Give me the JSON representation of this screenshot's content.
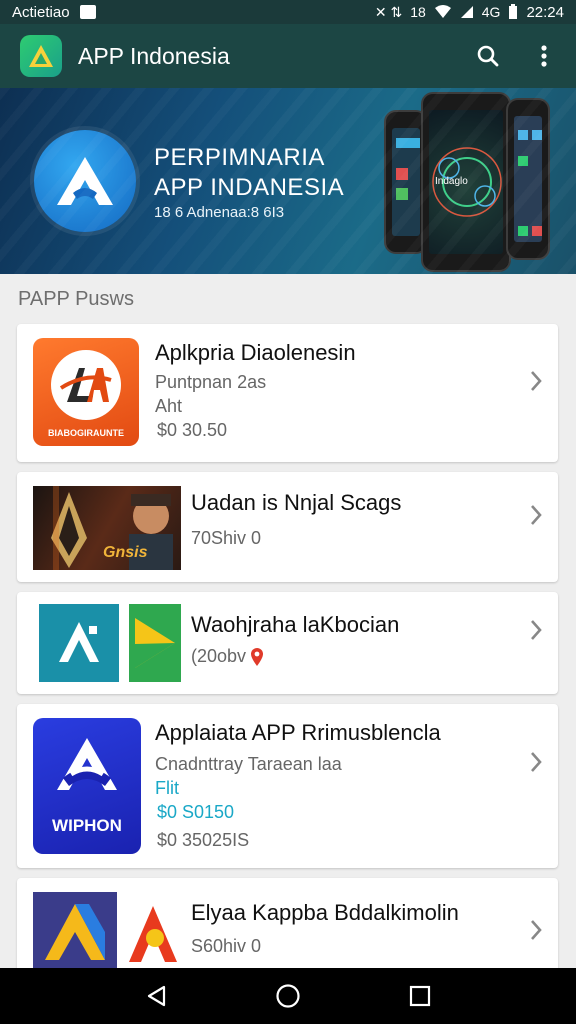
{
  "status_bar": {
    "carrier": "Actietiao",
    "time": "22:24",
    "indicators": "✕ ⇅",
    "signal_text": "18",
    "network_text": "4G"
  },
  "app_bar": {
    "title": "APP Indonesia",
    "icons": [
      "app-logo-icon",
      "search-icon",
      "more-vert-icon"
    ]
  },
  "banner": {
    "title_line1": "PERPIMNARIA",
    "title_line2": "APP INDANESIA",
    "subtitle": "18 6 Adnenaa:8 6I3",
    "phone_text": "Indaglo"
  },
  "section": {
    "title": "PAPP Pusws"
  },
  "apps": [
    {
      "name": "Aplkpria Diaolenesin",
      "line1": "Puntpnan 2as",
      "line2": "Aht",
      "price": "$0 30.50",
      "thumb_label": "BIABOGIRAUNTE",
      "icon": "la-logo-icon"
    },
    {
      "name": "Uadan is Nnjal Scags",
      "line1": "70Shiv 0",
      "thumb_label": "Gnsis",
      "icon": "game-art-icon"
    },
    {
      "name": "Waohjraha laKbocian",
      "line1": "(20obv",
      "icon": "a-logo-icon"
    },
    {
      "name": "Applaiata APP Rrimusblencla",
      "line1": "Cnadnttray Taraean laa",
      "line2": "Flit",
      "line3": "$0 S0150",
      "line4": "$0 35025IS",
      "thumb_label": "WIPHON",
      "icon": "wiphon-logo-icon"
    },
    {
      "name": "Elyaa Kappba Bddalkimolin",
      "line1": "S60hiv 0",
      "icon": "drive-logo-icon"
    }
  ],
  "colors": {
    "app_bar": "#1c4644",
    "status_bar": "#1b3a3a",
    "accent_teal": "#1aa8c7",
    "banner": "#144f7a"
  }
}
